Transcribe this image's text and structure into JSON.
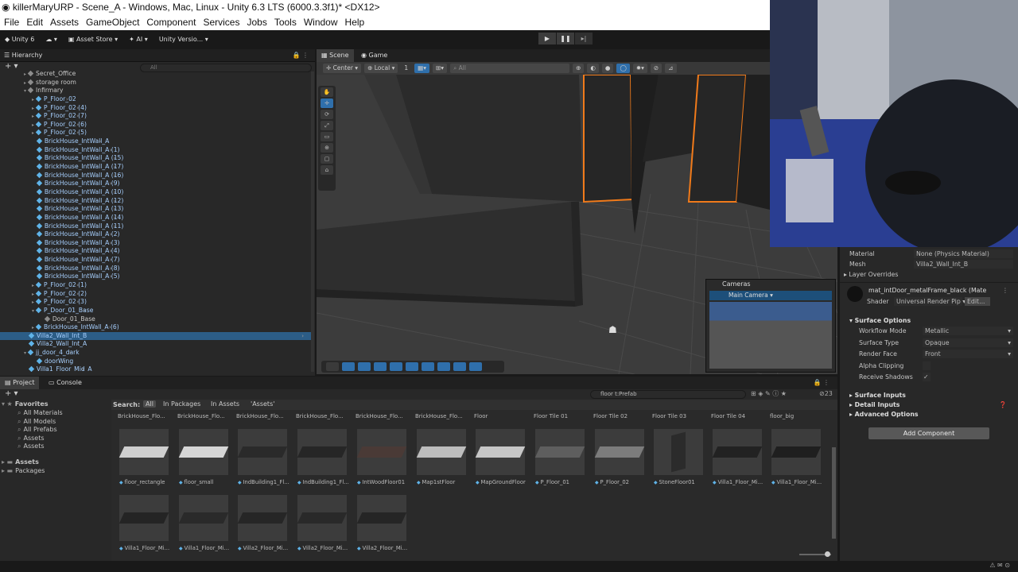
{
  "window": {
    "title": "killerMaryURP - Scene_A - Windows, Mac, Linux - Unity 6.3 LTS (6000.3.3f1)* <DX12>"
  },
  "menu": [
    "File",
    "Edit",
    "Assets",
    "GameObject",
    "Component",
    "Services",
    "Jobs",
    "Tools",
    "Window",
    "Help"
  ],
  "toolbar": {
    "account": "Unity 6",
    "asset_store": "Asset Store",
    "ai": "AI",
    "version": "Unity Versio..."
  },
  "hierarchy": {
    "tab": "Hierarchy",
    "search_placeholder": "All",
    "rows": [
      {
        "label": "Secret_Office",
        "type": "go",
        "indent": 2,
        "fold": "▸"
      },
      {
        "label": "storage room",
        "type": "go",
        "indent": 2,
        "fold": "▸"
      },
      {
        "label": "Infirmary",
        "type": "go",
        "indent": 2,
        "fold": "▾"
      },
      {
        "label": "P_Floor_02",
        "type": "prefab",
        "indent": 3,
        "fold": "▸"
      },
      {
        "label": "P_Floor_02 (4)",
        "type": "prefab",
        "indent": 3,
        "fold": "▸"
      },
      {
        "label": "P_Floor_02 (7)",
        "type": "prefab",
        "indent": 3,
        "fold": "▸"
      },
      {
        "label": "P_Floor_02 (6)",
        "type": "prefab",
        "indent": 3,
        "fold": "▸"
      },
      {
        "label": "P_Floor_02 (5)",
        "type": "prefab",
        "indent": 3,
        "fold": "▸"
      },
      {
        "label": "BrickHouse_IntWall_A",
        "type": "prefab",
        "indent": 3,
        "fold": ""
      },
      {
        "label": "BrickHouse_IntWall_A (1)",
        "type": "prefab",
        "indent": 3,
        "fold": ""
      },
      {
        "label": "BrickHouse_IntWall_A (15)",
        "type": "prefab",
        "indent": 3,
        "fold": ""
      },
      {
        "label": "BrickHouse_IntWall_A (17)",
        "type": "prefab",
        "indent": 3,
        "fold": ""
      },
      {
        "label": "BrickHouse_IntWall_A (16)",
        "type": "prefab",
        "indent": 3,
        "fold": ""
      },
      {
        "label": "BrickHouse_IntWall_A (9)",
        "type": "prefab",
        "indent": 3,
        "fold": ""
      },
      {
        "label": "BrickHouse_IntWall_A (10)",
        "type": "prefab",
        "indent": 3,
        "fold": ""
      },
      {
        "label": "BrickHouse_IntWall_A (12)",
        "type": "prefab",
        "indent": 3,
        "fold": ""
      },
      {
        "label": "BrickHouse_IntWall_A (13)",
        "type": "prefab",
        "indent": 3,
        "fold": ""
      },
      {
        "label": "BrickHouse_IntWall_A (14)",
        "type": "prefab",
        "indent": 3,
        "fold": ""
      },
      {
        "label": "BrickHouse_IntWall_A (11)",
        "type": "prefab",
        "indent": 3,
        "fold": ""
      },
      {
        "label": "BrickHouse_IntWall_A (2)",
        "type": "prefab",
        "indent": 3,
        "fold": ""
      },
      {
        "label": "BrickHouse_IntWall_A (3)",
        "type": "prefab",
        "indent": 3,
        "fold": ""
      },
      {
        "label": "BrickHouse_IntWall_A (4)",
        "type": "prefab",
        "indent": 3,
        "fold": ""
      },
      {
        "label": "BrickHouse_IntWall_A (7)",
        "type": "prefab",
        "indent": 3,
        "fold": ""
      },
      {
        "label": "BrickHouse_IntWall_A (8)",
        "type": "prefab",
        "indent": 3,
        "fold": ""
      },
      {
        "label": "BrickHouse_IntWall_A (5)",
        "type": "prefab",
        "indent": 3,
        "fold": ""
      },
      {
        "label": "P_Floor_02 (1)",
        "type": "prefab",
        "indent": 3,
        "fold": "▸"
      },
      {
        "label": "P_Floor_02 (2)",
        "type": "prefab",
        "indent": 3,
        "fold": "▸"
      },
      {
        "label": "P_Floor_02 (3)",
        "type": "prefab",
        "indent": 3,
        "fold": "▸"
      },
      {
        "label": "P_Door_01_Base",
        "type": "prefab",
        "indent": 3,
        "fold": "▾"
      },
      {
        "label": "Door_01_Base",
        "type": "go",
        "indent": 4,
        "fold": ""
      },
      {
        "label": "BrickHouse_IntWall_A (6)",
        "type": "prefab",
        "indent": 3,
        "fold": "▸"
      },
      {
        "label": "Villa2_Wall_Int_B",
        "type": "prefab",
        "indent": 2,
        "fold": "",
        "selected": true
      },
      {
        "label": "Villa2_Wall_Int_A",
        "type": "prefab",
        "indent": 2,
        "fold": ""
      },
      {
        "label": "jj_door_4_dark",
        "type": "prefab",
        "indent": 2,
        "fold": "▾"
      },
      {
        "label": "doorWing",
        "type": "prefab",
        "indent": 3,
        "fold": ""
      },
      {
        "label": "Villa1_Floor_Mid_A",
        "type": "prefab",
        "indent": 2,
        "fold": ""
      }
    ]
  },
  "scene": {
    "tabs": [
      "Scene",
      "Game"
    ],
    "pivot": "Center",
    "space": "Local",
    "grid_value": "1",
    "search_placeholder": "All"
  },
  "cameras": {
    "title": "Cameras",
    "selected": "Main Camera"
  },
  "inspector": {
    "material_label": "Material",
    "material_value": "None (Physics Material)",
    "mesh_label": "Mesh",
    "mesh_value": "Villa2_Wall_Int_B",
    "layer_overrides": "Layer Overrides",
    "mat_name": "mat_intDoor_metalFrame_black (Mate",
    "shader_label": "Shader",
    "shader_value": "Universal Render Pip",
    "edit_label": "Edit...",
    "surface_options": "Surface Options",
    "props": [
      {
        "label": "Workflow Mode",
        "value": "Metallic"
      },
      {
        "label": "Surface Type",
        "value": "Opaque"
      },
      {
        "label": "Render Face",
        "value": "Front"
      },
      {
        "label": "Alpha Clipping",
        "value": ""
      },
      {
        "label": "Receive Shadows",
        "value": "✓"
      }
    ],
    "surface_inputs": "Surface Inputs",
    "detail_inputs": "Detail Inputs",
    "advanced_options": "Advanced Options",
    "add_component": "Add Component"
  },
  "project": {
    "tabs": [
      "Project",
      "Console"
    ],
    "search_value": "floor t:Prefab",
    "count": "23",
    "search_label": "Search:",
    "filters": [
      "All",
      "In Packages",
      "In Assets",
      "'Assets'"
    ],
    "favorites_label": "Favorites",
    "favorites": [
      "All Materials",
      "All Models",
      "All Prefabs",
      "Assets",
      "Assets"
    ],
    "roots": [
      "Assets",
      "Packages"
    ],
    "top_row_names": [
      "BrickHouse_Flo...",
      "BrickHouse_Flo...",
      "BrickHouse_Flo...",
      "BrickHouse_Flo...",
      "BrickHouse_Flo...",
      "BrickHouse_Flo...",
      "Floor",
      "Floor Tile 01",
      "Floor Tile 02",
      "Floor Tile 03",
      "Floor Tile 04",
      "floor_big"
    ],
    "assets_row1": [
      {
        "name": "floor_rectangle",
        "color": "#cfcfcf"
      },
      {
        "name": "floor_small",
        "color": "#d6d6d6"
      },
      {
        "name": "IndBuilding1_Fl...",
        "color": "#2a2a2a"
      },
      {
        "name": "IndBuilding1_Fl...",
        "color": "#262626"
      },
      {
        "name": "IntWoodFloor01",
        "color": "#4a3a36"
      },
      {
        "name": "Map1stFloor",
        "color": "#bdbdbd"
      },
      {
        "name": "MapGroundFloor",
        "color": "#c6c6c6"
      },
      {
        "name": "P_Floor_01",
        "color": "#5e5e5e"
      },
      {
        "name": "P_Floor_02",
        "color": "#7c7c7c"
      },
      {
        "name": "StoneFloor01",
        "color": "#2b2b2b"
      },
      {
        "name": "Villa1_Floor_Mi...",
        "color": "#222222"
      },
      {
        "name": "Villa1_Floor_Mi...",
        "color": "#1f1f1f"
      }
    ],
    "assets_row2": [
      {
        "name": "Villa1_Floor_Mi...",
        "color": "#242424"
      },
      {
        "name": "Villa1_Floor_Mi...",
        "color": "#2a2a2a"
      },
      {
        "name": "Villa2_Floor_Mi...",
        "color": "#262626"
      },
      {
        "name": "Villa2_Floor_Mi...",
        "color": "#292929"
      },
      {
        "name": "Villa2_Floor_Mi...",
        "color": "#252525"
      }
    ]
  },
  "colors": {
    "selection": "#2c5d87",
    "prefab_text": "#a7d0ff",
    "accent": "#2f6fab",
    "outline": "#f07a1a"
  }
}
